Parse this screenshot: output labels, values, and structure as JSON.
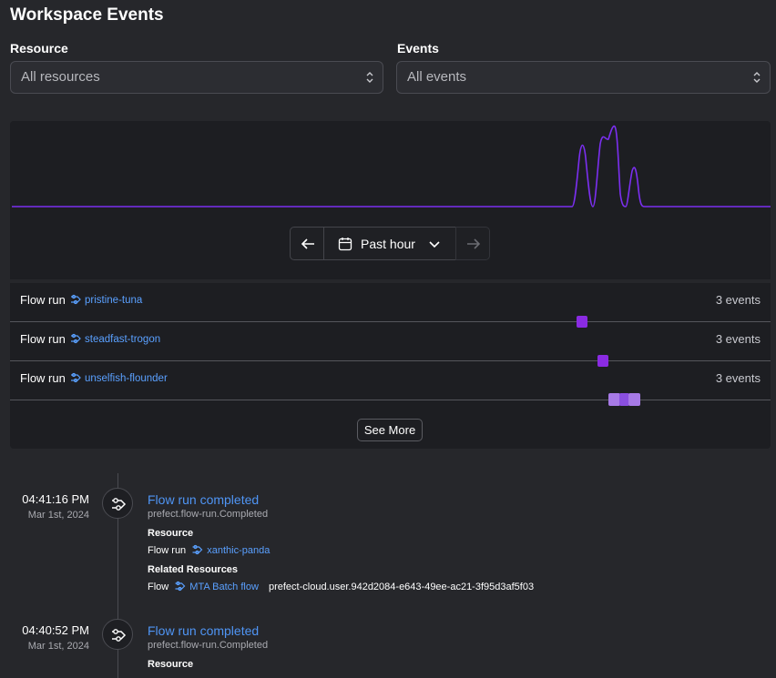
{
  "page": {
    "title": "Workspace Events"
  },
  "filters": {
    "resource": {
      "label": "Resource",
      "value": "All resources"
    },
    "events": {
      "label": "Events",
      "value": "All events"
    }
  },
  "histogram": {
    "line_color": "#7b2ff0",
    "background": "#1d1e22"
  },
  "time_nav": {
    "range_label": "Past hour",
    "prev_icon": "arrow-left-icon",
    "next_icon": "arrow-right-icon",
    "calendar_icon": "calendar-icon"
  },
  "resource_rows": [
    {
      "type": "Flow run",
      "name": "pristine-tuna",
      "count": "3 events"
    },
    {
      "type": "Flow run",
      "name": "steadfast-trogon",
      "count": "3 events"
    },
    {
      "type": "Flow run",
      "name": "unselfish-flounder",
      "count": "3 events"
    }
  ],
  "see_more": "See More",
  "events": [
    {
      "time": "04:41:16 PM",
      "date": "Mar 1st, 2024",
      "title": "Flow run completed",
      "event_name": "prefect.flow-run.Completed",
      "resource_heading": "Resource",
      "resource_type": "Flow run",
      "resource_name": "xanthic-panda",
      "related_heading": "Related Resources",
      "related_type": "Flow",
      "related_name": "MTA Batch flow",
      "related_user": "prefect-cloud.user.942d2084-e643-49ee-ac21-3f95d3af5f03"
    },
    {
      "time": "04:40:52 PM",
      "date": "Mar 1st, 2024",
      "title": "Flow run completed",
      "event_name": "prefect.flow-run.Completed",
      "resource_heading": "Resource"
    }
  ],
  "colors": {
    "accent": "#8a2be2",
    "link": "#5aa0ff",
    "title_link": "#4f95f5"
  }
}
